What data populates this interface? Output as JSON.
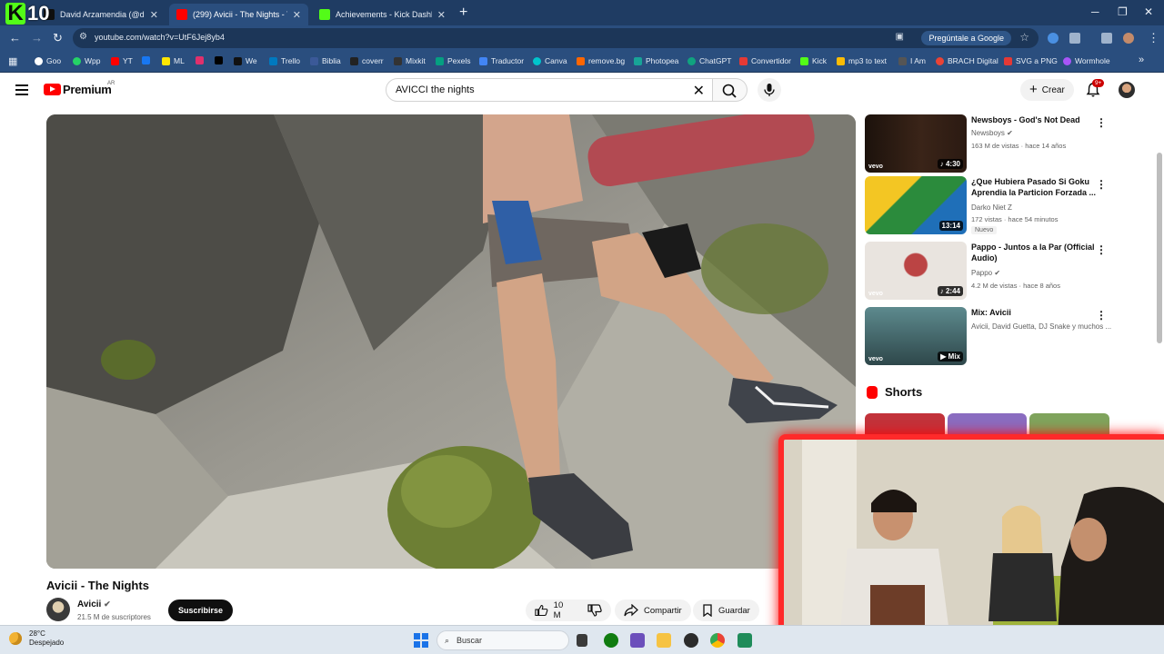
{
  "browser": {
    "tabs": [
      {
        "title": "David Arzamendia (@davi",
        "favicon_color": "#0f0f0f",
        "active": false
      },
      {
        "title": "(299) Avicii - The Nights - YouT",
        "favicon_color": "#ff0000",
        "active": true
      },
      {
        "title": "Achievements - Kick Dashboard",
        "favicon_color": "#53fc18",
        "active": false
      }
    ],
    "new_tab_icon": "plus-icon",
    "address": "youtube.com/watch?v=UtF6Jej8yb4",
    "google_pill": "Pregúntale a Google",
    "overlay_logo": {
      "k": "K",
      "n": "10"
    },
    "bookmarks": [
      {
        "label": "Goo",
        "color": "#ffffff"
      },
      {
        "label": "Wpp",
        "color": "#25d366"
      },
      {
        "label": "YT",
        "color": "#ff0000"
      },
      {
        "label": "",
        "color": "#1877f2"
      },
      {
        "label": "ML",
        "color": "#ffe600"
      },
      {
        "label": "",
        "color": "#e1306c"
      },
      {
        "label": "",
        "color": "#000000"
      },
      {
        "label": "We",
        "color": "#111111"
      },
      {
        "label": "Trello",
        "color": "#0079bf"
      },
      {
        "label": "Biblia",
        "color": "#3b5998"
      },
      {
        "label": "coverr",
        "color": "#222222"
      },
      {
        "label": "Mixkit",
        "color": "#333333"
      },
      {
        "label": "Pexels",
        "color": "#05a081"
      },
      {
        "label": "Traductor",
        "color": "#4285f4"
      },
      {
        "label": "Canva",
        "color": "#00c4cc"
      },
      {
        "label": "remove.bg",
        "color": "#ff6600"
      },
      {
        "label": "Photopea",
        "color": "#18a497"
      },
      {
        "label": "ChatGPT",
        "color": "#10a37f"
      },
      {
        "label": "Convertidor",
        "color": "#e53935"
      },
      {
        "label": "Kick",
        "color": "#53fc18"
      },
      {
        "label": "mp3 to text",
        "color": "#fbbc05"
      },
      {
        "label": "I Am",
        "color": "#555555"
      },
      {
        "label": "BRACH Digital",
        "color": "#ea4335"
      },
      {
        "label": "SVG a PNG",
        "color": "#e53935"
      },
      {
        "label": "Wormhole",
        "color": "#a855f7"
      }
    ]
  },
  "youtube": {
    "logo_text": "Premium",
    "country": "AR",
    "search_query": "AVICCI the nights",
    "create_label": "Crear",
    "notifications": "9+",
    "video_title": "Avicii - The Nights",
    "channel": {
      "name": "Avicii",
      "subs": "21.5 M de suscriptores",
      "subscribe": "Suscribirse"
    },
    "actions": {
      "likes": "10 M",
      "share": "Compartir",
      "save": "Guardar"
    },
    "recommendations": [
      {
        "title": "Newsboys - God's Not Dead",
        "channel": "Newsboys",
        "meta": "163 M de vistas · hace 14 años",
        "duration": "4:30",
        "vevo": "vevo",
        "thumb": "#2b1a12"
      },
      {
        "title": "¿Que Hubiera Pasado Si Goku Aprendia la Particion Forzada ...",
        "channel": "Darko Niet Z",
        "meta": "172 vistas · hace 54 minutos",
        "duration": "13:14",
        "badge": "Nuevo",
        "thumb": "#1f6fb8"
      },
      {
        "title": "Pappo - Juntos a la Par (Official Audio)",
        "channel": "Pappo",
        "meta": "4.2 M de vistas · hace 8 años",
        "duration": "2:44",
        "vevo": "vevo",
        "thumb": "#e9e4df"
      },
      {
        "title": "Mix: Avicii",
        "channel": "Avicii, David Guetta, DJ Snake y muchos ...",
        "duration": "Mix",
        "vevo": "vevo",
        "thumb": "#3c5f63"
      }
    ],
    "shorts_label": "Shorts"
  },
  "taskbar": {
    "temp": "28°C",
    "weather": "Despejado",
    "search_placeholder": "Buscar"
  }
}
